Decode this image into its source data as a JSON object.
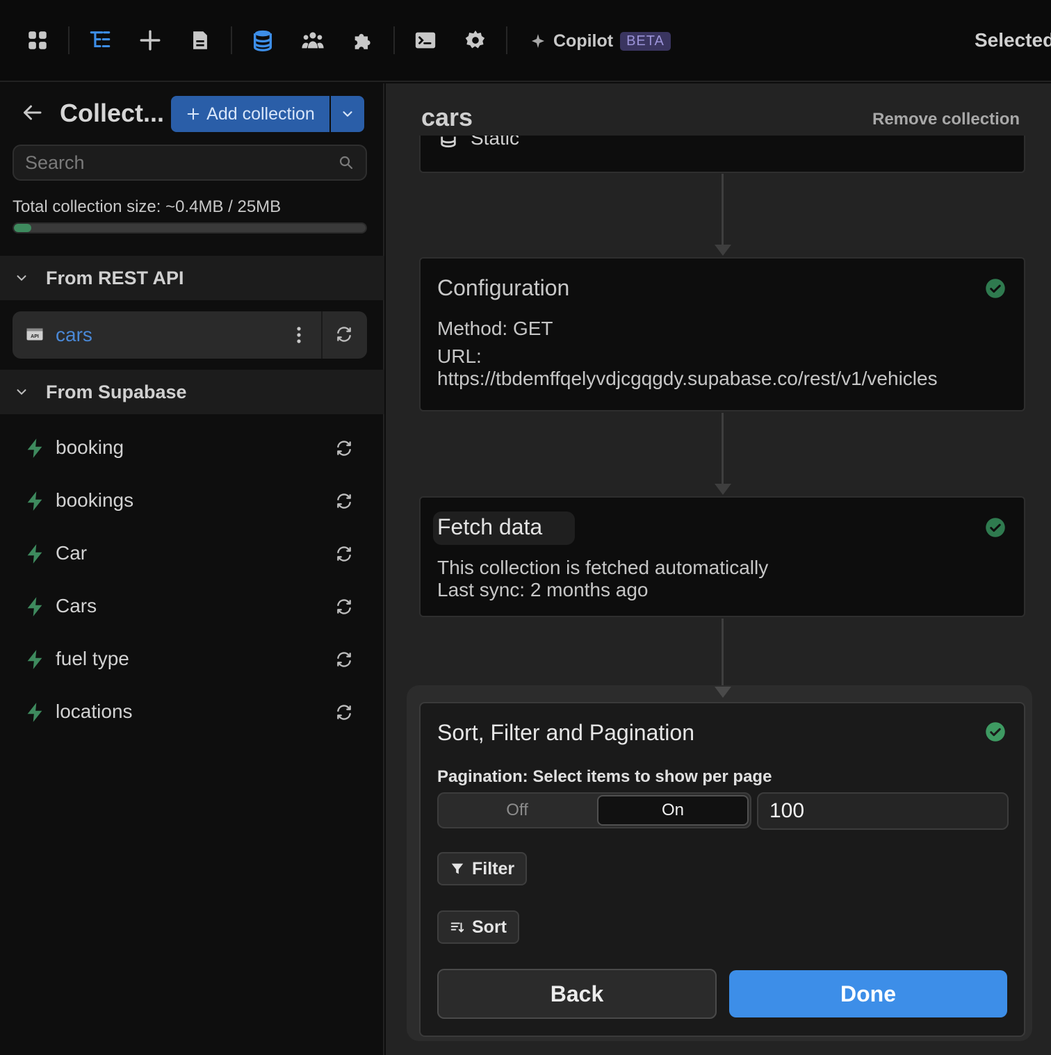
{
  "toolbar": {
    "copilot_label": "Copilot",
    "beta_badge": "BETA",
    "selected_label": "Selected"
  },
  "sidebar": {
    "title": "Collect...",
    "add_collection_label": "Add collection",
    "search_placeholder": "Search",
    "size_label": "Total collection size: ~0.4MB / 25MB",
    "size_fraction": 0.016,
    "groups": [
      {
        "label": "From REST API"
      },
      {
        "label": "From Supabase"
      }
    ],
    "api_items": [
      {
        "name": "cars",
        "badge": "API"
      }
    ],
    "supabase_items": [
      {
        "name": "booking"
      },
      {
        "name": "bookings"
      },
      {
        "name": "Car"
      },
      {
        "name": "Cars"
      },
      {
        "name": "fuel type"
      },
      {
        "name": "locations"
      }
    ],
    "accent_color": "#4a88d6",
    "bolt_color": "#3e8a5e"
  },
  "main": {
    "collection_name": "cars",
    "remove_label": "Remove collection",
    "static_label": "Static",
    "configuration": {
      "title": "Configuration",
      "method": "Method: GET",
      "url_label": "URL:",
      "url": "https://tbdemffqelyvdjcgqgdy.supabase.co/rest/v1/vehicles"
    },
    "fetch": {
      "title": "Fetch data",
      "line1": "This collection is fetched automatically",
      "line2": "Last sync: 2 months ago"
    },
    "sfp": {
      "title": "Sort, Filter and Pagination",
      "pagination_label": "Pagination: Select items to show per page",
      "off_label": "Off",
      "on_label": "On",
      "per_page": "100",
      "filter_label": "Filter",
      "sort_label": "Sort",
      "back_label": "Back",
      "done_label": "Done"
    },
    "check_color": "#3e8a5e",
    "done_color": "#3d8ee8"
  }
}
